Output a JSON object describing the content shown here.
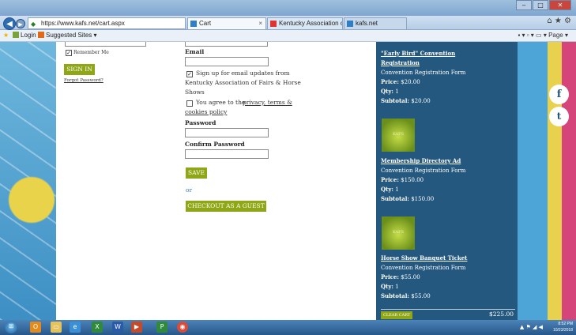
{
  "browser": {
    "url": "https://www.kafs.net/cart.aspx",
    "tabs": [
      {
        "label": "Cart",
        "close": "×"
      },
      {
        "label": "Kentucky Association of...",
        "close": "×"
      },
      {
        "label": "kafs.net"
      }
    ],
    "window_controls": {
      "minimize": "‒",
      "maximize": "□",
      "close": "✕"
    },
    "favorites_bar": {
      "login": "Login",
      "suggested": "Suggested Sites ▾"
    },
    "command_bar": {
      "page": "▪ ▾ ▫ ▾ ▭ ▾  Page ▾"
    }
  },
  "login": {
    "remember_label": "Remember Me",
    "signin_label": "SIGN IN",
    "forgot_label": "Forgot Password?"
  },
  "register": {
    "email_label": "Email",
    "signup_line1": "Sign up for email updates from",
    "signup_line2": "Kentucky Association of Fairs & Horse",
    "signup_line3": "Shows",
    "agree_prefix": "You agree to the",
    "agree_link1": "privacy, terms &",
    "agree_link2": "cookies policy",
    "password_label": "Password",
    "confirm_label": "Confirm Password",
    "save_label": "SAVE",
    "or_label": "or",
    "guest_label": "CHECKOUT AS A GUEST"
  },
  "cart": {
    "items": [
      {
        "title1": "\"Early Bird\" Convention",
        "title2": "Registration",
        "form": "Convention Registration Form",
        "price_label": "Price:",
        "price": "$20.00",
        "qty_label": "Qty:",
        "qty": "1",
        "subtotal_label": "Subtotal:",
        "subtotal": "$20.00"
      },
      {
        "title1": "Membership Directory Ad",
        "form": "Convention Registration Form",
        "price_label": "Price:",
        "price": "$150.00",
        "qty_label": "Qty:",
        "qty": "1",
        "subtotal_label": "Subtotal:",
        "subtotal": "$150.00"
      },
      {
        "title1": "Horse Show Banquet Ticket",
        "form": "Convention Registration Form",
        "price_label": "Price:",
        "price": "$55.00",
        "qty_label": "Qty:",
        "qty": "1",
        "subtotal_label": "Subtotal:",
        "subtotal": "$55.00"
      }
    ],
    "clear_label": "CLEAR CART",
    "total": "$225.00"
  },
  "taskbar": {
    "time": "8:52 PM",
    "date": "10/23/2018"
  },
  "colors": {
    "accent_green": "#8fa616",
    "cart_bg": "#24587e"
  }
}
